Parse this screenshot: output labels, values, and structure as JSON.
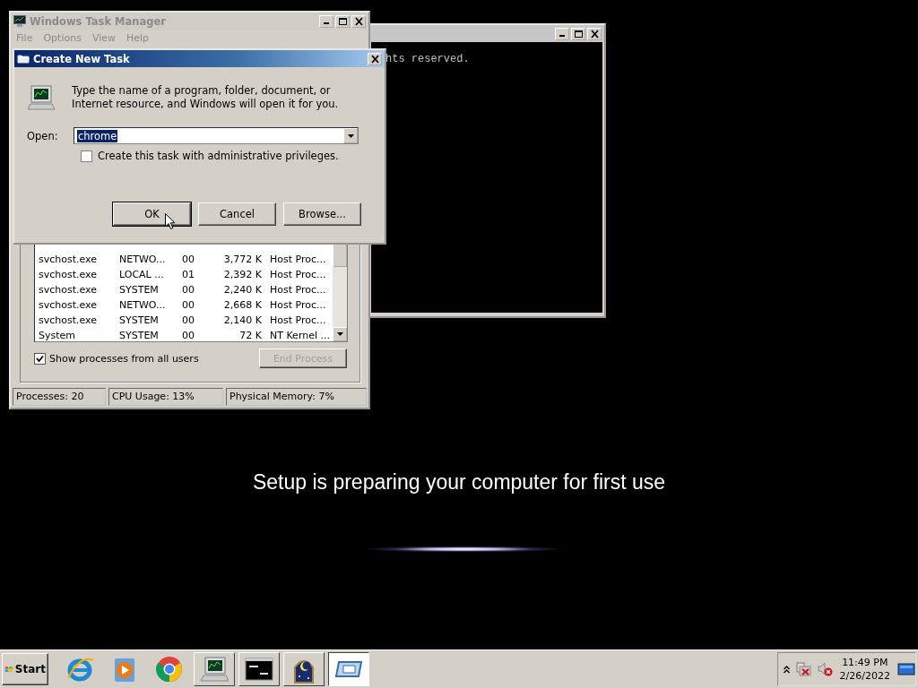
{
  "console": {
    "lines": [
      "hts reserved."
    ]
  },
  "task_manager": {
    "title": "Windows Task Manager",
    "active": false,
    "menu": [
      "File",
      "Options",
      "View",
      "Help"
    ],
    "processes": [
      {
        "name": "svchost.exe",
        "user": "NETWO...",
        "cpu": "00",
        "memory": "3,772 K",
        "description": "Host Proc..."
      },
      {
        "name": "svchost.exe",
        "user": "LOCAL ...",
        "cpu": "01",
        "memory": "2,392 K",
        "description": "Host Proc..."
      },
      {
        "name": "svchost.exe",
        "user": "SYSTEM",
        "cpu": "00",
        "memory": "2,240 K",
        "description": "Host Proc..."
      },
      {
        "name": "svchost.exe",
        "user": "NETWO...",
        "cpu": "00",
        "memory": "2,668 K",
        "description": "Host Proc..."
      },
      {
        "name": "svchost.exe",
        "user": "SYSTEM",
        "cpu": "00",
        "memory": "2,140 K",
        "description": "Host Proc..."
      },
      {
        "name": "System",
        "user": "SYSTEM",
        "cpu": "00",
        "memory": "72 K",
        "description": "NT Kernel ..."
      }
    ],
    "show_all_users": {
      "label": "Show processes from all users",
      "checked": true
    },
    "end_process": {
      "label": "End Process",
      "disabled": true
    },
    "status_bar": [
      "Processes: 20",
      "CPU Usage: 13%",
      "Physical Memory: 7%"
    ]
  },
  "create_task_dialog": {
    "title": "Create New Task",
    "message": "Type the name of a program, folder, document, or Internet resource, and Windows will open it for you.",
    "open_label": "Open:",
    "open_value": "chrome",
    "value_selected": true,
    "admin_checkbox": {
      "label": "Create this task with administrative privileges.",
      "checked": false
    },
    "buttons": [
      {
        "label": "OK",
        "default": true
      },
      {
        "label": "Cancel",
        "default": false
      },
      {
        "label": "Browse...",
        "default": false
      }
    ]
  },
  "setup_message": "Setup is preparing your computer for first use",
  "taskbar": {
    "start_label": "Start",
    "items": [
      {
        "kind": "ie",
        "running": false,
        "selected": false
      },
      {
        "kind": "media",
        "running": false,
        "selected": false
      },
      {
        "kind": "chrome",
        "running": false,
        "selected": false
      },
      {
        "kind": "taskmgr",
        "running": true,
        "selected": false
      },
      {
        "kind": "cmd",
        "running": true,
        "selected": false
      },
      {
        "kind": "moon",
        "running": true,
        "selected": false
      },
      {
        "kind": "window",
        "running": true,
        "selected": true
      }
    ],
    "clock": {
      "time": "11:49 PM",
      "date": "2/26/2022"
    }
  }
}
